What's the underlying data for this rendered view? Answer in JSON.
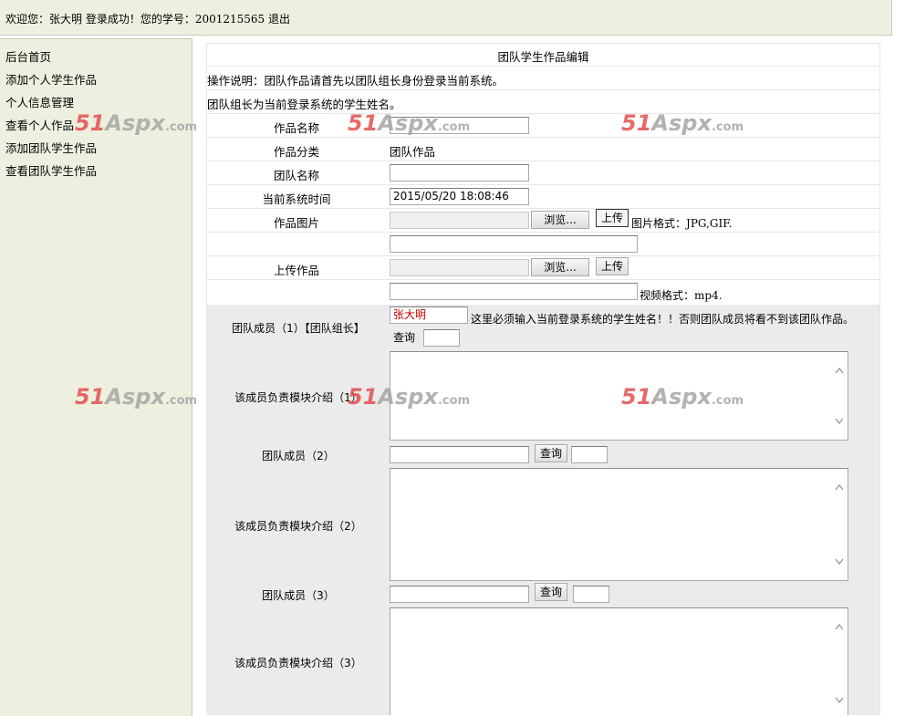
{
  "header": {
    "welcome_prefix": "欢迎您：张大明 登录成功！您的学号：",
    "student_no": "2001215565",
    "logout": "退出"
  },
  "sidebar": {
    "items": [
      {
        "label": "后台首页"
      },
      {
        "label": "添加个人学生作品"
      },
      {
        "label": "个人信息管理"
      },
      {
        "label": "查看个人作品"
      },
      {
        "label": "添加团队学生作品"
      },
      {
        "label": "查看团队学生作品"
      }
    ]
  },
  "form": {
    "title": "团队学生作品编辑",
    "note1": "操作说明：团队作品请首先以团队组长身份登录当前系统。",
    "note2": "团队组长为当前登录系统的学生姓名。",
    "work_name_label": "作品名称",
    "work_name_value": "",
    "category_label": "作品分类",
    "category_value": "团队作品",
    "team_name_label": "团队名称",
    "team_name_value": "",
    "system_time_label": "当前系统时间",
    "system_time_value": "2015/05/20 18:08:46",
    "image_label": "作品图片",
    "browse_label": "浏览...",
    "upload_label": "上传",
    "image_format_hint": "图片格式：",
    "image_format_value": "JPG,GIF.",
    "upload_work_label": "上传作品",
    "video_format_hint": "视频格式：",
    "video_format_value": "mp4.",
    "query_label": "查询",
    "member1_label": "团队成员（1）【团队组长】",
    "member1_value": "张大明",
    "member1_hint": "这里必须输入当前登录系统的学生姓名！！否则团队成员将看不到该团队作品。",
    "intro1_label": "该成员负责模块介绍（1）",
    "member2_label": "团队成员（2）",
    "intro2_label": "该成员负责模块介绍（2）",
    "member3_label": "团队成员（3）",
    "intro3_label": "该成员负责模块介绍（3）"
  },
  "watermark": {
    "part1": "51",
    "part2": "Aspx",
    "part3": ".com"
  },
  "colors": {
    "panel_bg": "#efefdf",
    "grey_section": "#ebebeb",
    "member_name_text": "#c00000",
    "watermark_red": "#e04040"
  }
}
